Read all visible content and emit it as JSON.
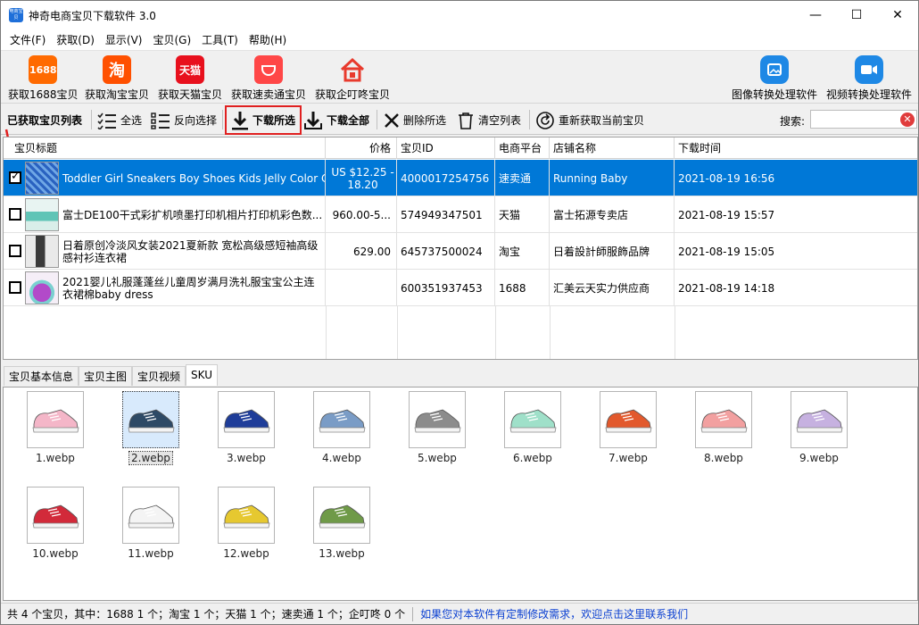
{
  "window": {
    "title": "神奇电商宝贝下载软件 3.0",
    "icon_text": "电商宝贝",
    "minimize": "—",
    "maximize": "☐",
    "close": "✕"
  },
  "menu": [
    "文件(F)",
    "获取(D)",
    "显示(V)",
    "宝贝(G)",
    "工具(T)",
    "帮助(H)"
  ],
  "toolbar": {
    "items": [
      {
        "label": "获取1688宝贝",
        "icon": "1688-icon",
        "icon_text": "1688",
        "color": "#ff6a00"
      },
      {
        "label": "获取淘宝宝贝",
        "icon": "taobao-icon",
        "icon_text": "淘",
        "color": "#ff5000"
      },
      {
        "label": "获取天猫宝贝",
        "icon": "tmall-icon",
        "icon_text": "天猫",
        "color": "#e8101d"
      },
      {
        "label": "获取速卖通宝贝",
        "icon": "aliexpress-icon",
        "icon_text": "",
        "color": "#ff4747"
      },
      {
        "label": "获取企叮咚宝贝",
        "icon": "house-icon",
        "icon_text": "",
        "color": "#e83a2d"
      }
    ],
    "right": [
      {
        "label": "图像转换处理软件",
        "icon": "image-convert-icon",
        "color": "#1e88e5"
      },
      {
        "label": "视频转换处理软件",
        "icon": "video-convert-icon",
        "color": "#1e88e5"
      }
    ]
  },
  "actions": {
    "list_title": "已获取宝贝列表",
    "select_all": "全选",
    "invert": "反向选择",
    "download_selected": "下载所选",
    "download_all": "下载全部",
    "delete_selected": "删除所选",
    "clear_list": "清空列表",
    "refresh": "重新获取当前宝贝",
    "search_label": "搜索:",
    "search_value": ""
  },
  "table": {
    "columns": [
      "宝贝标题",
      "价格",
      "宝贝ID",
      "电商平台",
      "店铺名称",
      "下载时间"
    ],
    "rows": [
      {
        "checked": true,
        "title": "Toddler Girl Sneakers Boy Shoes Kids Jelly Color Ca...",
        "price": "US $12.25 - 18.20",
        "id": "4000017254756",
        "platform": "速卖通",
        "shop": "Running Baby",
        "time": "2021-08-19 16:56"
      },
      {
        "checked": false,
        "title": "富士DE100干式彩扩机喷墨打印机相片打印机彩色数...",
        "price": "960.00-5...",
        "id": "574949347501",
        "platform": "天猫",
        "shop": "富士拓源专卖店",
        "time": "2021-08-19 15:57"
      },
      {
        "checked": false,
        "title": "日着原创冷淡风女装2021夏新款 宽松高级感短袖高级感衬衫连衣裙",
        "price": "629.00",
        "id": "645737500024",
        "platform": "淘宝",
        "shop": "日着設計師服飾品牌",
        "time": "2021-08-19 15:05"
      },
      {
        "checked": false,
        "title": "2021婴儿礼服蓬蓬丝儿童周岁满月洗礼服宝宝公主连衣裙棉baby dress",
        "price": "",
        "id": "600351937453",
        "platform": "1688",
        "shop": "汇美云天实力供应商",
        "time": "2021-08-19 14:18"
      }
    ]
  },
  "tabs": [
    "宝贝基本信息",
    "宝贝主图",
    "宝贝视频",
    "SKU"
  ],
  "active_tab": "SKU",
  "sku": [
    {
      "name": "1.webp",
      "color": "#f4b6c8"
    },
    {
      "name": "2.webp",
      "color": "#2e4a66"
    },
    {
      "name": "3.webp",
      "color": "#1f3d99"
    },
    {
      "name": "4.webp",
      "color": "#7a9cc6"
    },
    {
      "name": "5.webp",
      "color": "#8c8c8c"
    },
    {
      "name": "6.webp",
      "color": "#9fe0c9"
    },
    {
      "name": "7.webp",
      "color": "#e2592d"
    },
    {
      "name": "8.webp",
      "color": "#f2a0a0"
    },
    {
      "name": "9.webp",
      "color": "#c6b1e0"
    },
    {
      "name": "10.webp",
      "color": "#d22a3a"
    },
    {
      "name": "11.webp",
      "color": "#f4f4f4"
    },
    {
      "name": "12.webp",
      "color": "#e6c830"
    },
    {
      "name": "13.webp",
      "color": "#6f9a48"
    }
  ],
  "status": {
    "summary": "共 4 个宝贝，其中：1688 1 个；淘宝 1 个；天猫 1 个；速卖通 1 个；企叮咚 0 个",
    "link": "如果您对本软件有定制修改需求，欢迎点击这里联系我们"
  }
}
